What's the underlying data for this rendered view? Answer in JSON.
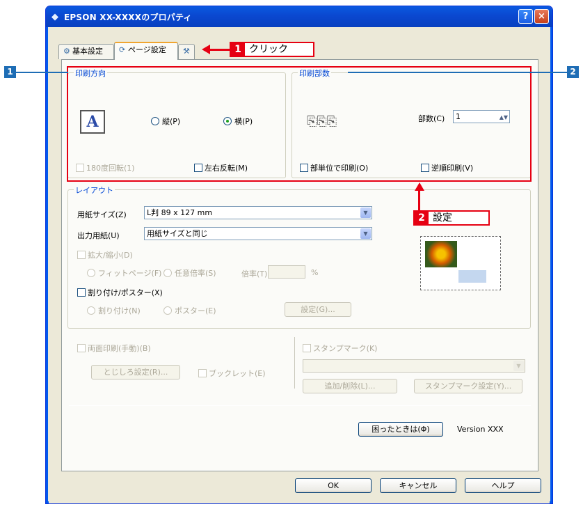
{
  "window": {
    "title": "EPSON XX-XXXXのプロパティ",
    "help_glyph": "?",
    "close_glyph": "×"
  },
  "tabs": [
    {
      "label": "基本設定"
    },
    {
      "label": "ページ設定"
    }
  ],
  "orientation": {
    "legend": "印刷方向",
    "portrait": "縦(P)",
    "landscape": "横(P)",
    "selected": "landscape",
    "rotate180": "180度回転(1)",
    "mirror": "左右反転(M)"
  },
  "copies": {
    "legend": "印刷部数",
    "label": "部数(C)",
    "value": "1",
    "collate": "部単位で印刷(O)",
    "reverse": "逆順印刷(V)"
  },
  "layout": {
    "legend": "レイアウト",
    "paper_size_label": "用紙サイズ(Z)",
    "paper_size_value": "L判 89 x 127 mm",
    "output_paper_label": "出力用紙(U)",
    "output_paper_value": "用紙サイズと同じ",
    "scale_label": "拡大/縮小(D)",
    "fit_page": "フィットページ(F)",
    "custom_scale": "任意倍率(S)",
    "ratio_label": "倍率(T)",
    "ratio_unit": "%",
    "nup_poster_label": "割り付け/ポスター(X)",
    "nup": "割り付け(N)",
    "poster": "ポスター(E)",
    "settings_button": "設定(G)..."
  },
  "duplex": {
    "label": "両面印刷(手動)(B)",
    "binding_button": "とじしろ設定(R)...",
    "booklet": "ブックレット(E)"
  },
  "stamp": {
    "label": "スタンプマーク(K)",
    "add_remove_button": "追加/削除(L)...",
    "settings_button": "スタンプマーク設定(Y)..."
  },
  "footer": {
    "trouble_button": "困ったときは(Φ)",
    "version": "Version XXX",
    "ok": "OK",
    "cancel": "キャンセル",
    "help": "ヘルプ"
  },
  "annotations": {
    "badge1_left": "1",
    "badge2_right": "2",
    "callout1_num": "1",
    "callout1_text": "クリック",
    "callout2_num": "2",
    "callout2_text": "設定"
  }
}
